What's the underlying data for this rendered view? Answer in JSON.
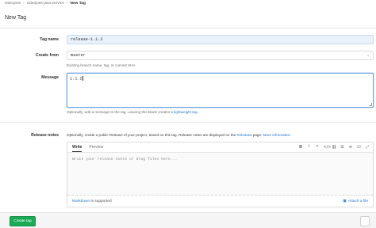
{
  "breadcrumbs": {
    "group": "videojoss",
    "project": "videojoss-java-service",
    "current": "New Tag"
  },
  "page": {
    "title": "New Tag"
  },
  "form": {
    "tag_name": {
      "label": "Tag name",
      "value": "release-1.1.2"
    },
    "create_from": {
      "label": "Create from",
      "value": "master",
      "help": "Existing branch name, tag, or commit SHA"
    },
    "message": {
      "label": "Message",
      "value": "1.1.2",
      "help_prefix": "Optionally, add a message to the tag. Leaving this blank creates a ",
      "help_link": "lightweight tag."
    },
    "release_notes": {
      "label": "Release notes",
      "help_prefix": "Optionally, create a public Release of your project, based on this tag. Release notes are displayed on the ",
      "help_link_releases": "Releases",
      "help_mid": " page. ",
      "help_link_more": "More information",
      "tab_write": "Write",
      "tab_preview": "Preview",
      "placeholder": "Write your release notes or drag files here...",
      "markdown_link": "Markdown",
      "markdown_suffix": " is supported",
      "attach_label": "Attach a file"
    }
  },
  "toolbar_icons": [
    "bold-icon",
    "italic-icon",
    "quote-icon",
    "code-icon",
    "link-icon",
    "bullet-list-icon",
    "numbered-list-icon",
    "task-list-icon",
    "fullscreen-icon"
  ],
  "actions": {
    "create_label": "Create tag"
  },
  "colors": {
    "primary_green": "#1aaa55",
    "link_blue": "#1f78d1",
    "focus_blue": "#6aa3de",
    "highlight_input": "#e9f1fb"
  }
}
